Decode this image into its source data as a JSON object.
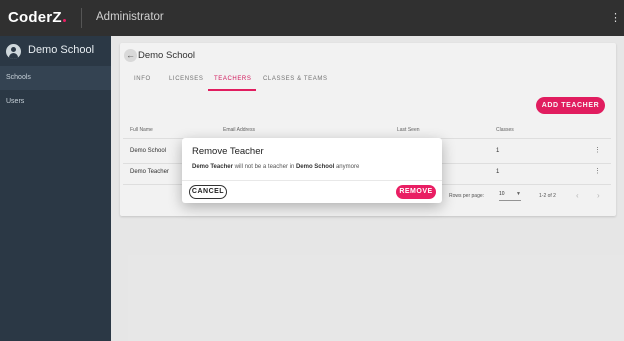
{
  "app": {
    "logo": "CoderZ",
    "title": "Administrator"
  },
  "sidebar": {
    "school_name": "Demo School",
    "items": [
      {
        "label": "Schools"
      },
      {
        "label": "Users"
      }
    ]
  },
  "page": {
    "title": "Demo School",
    "tabs": [
      {
        "label": "INFO"
      },
      {
        "label": "LICENSES"
      },
      {
        "label": "TEACHERS",
        "active": true
      },
      {
        "label": "CLASSES & TEAMS"
      }
    ],
    "add_button": "ADD TEACHER"
  },
  "table": {
    "headers": [
      "Full Name",
      "Email Address",
      "Last Seen",
      "Classes"
    ],
    "rows": [
      {
        "name": "Demo School",
        "classes": "1"
      },
      {
        "name": "Demo Teacher",
        "classes": "1"
      }
    ],
    "rows_per_page_label": "Rows per page:",
    "rows_per_page": "10",
    "range": "1-2 of 2"
  },
  "dialog": {
    "title": "Remove Teacher",
    "message_subject": "Demo Teacher",
    "message_middle": " will not be a teacher in ",
    "message_school": "Demo School",
    "message_end": " anymore",
    "cancel": "CANCEL",
    "confirm": "REMOVE"
  },
  "colors": {
    "accent": "#e91e63",
    "sidebar": "#2b3845",
    "topbar": "#303030"
  }
}
